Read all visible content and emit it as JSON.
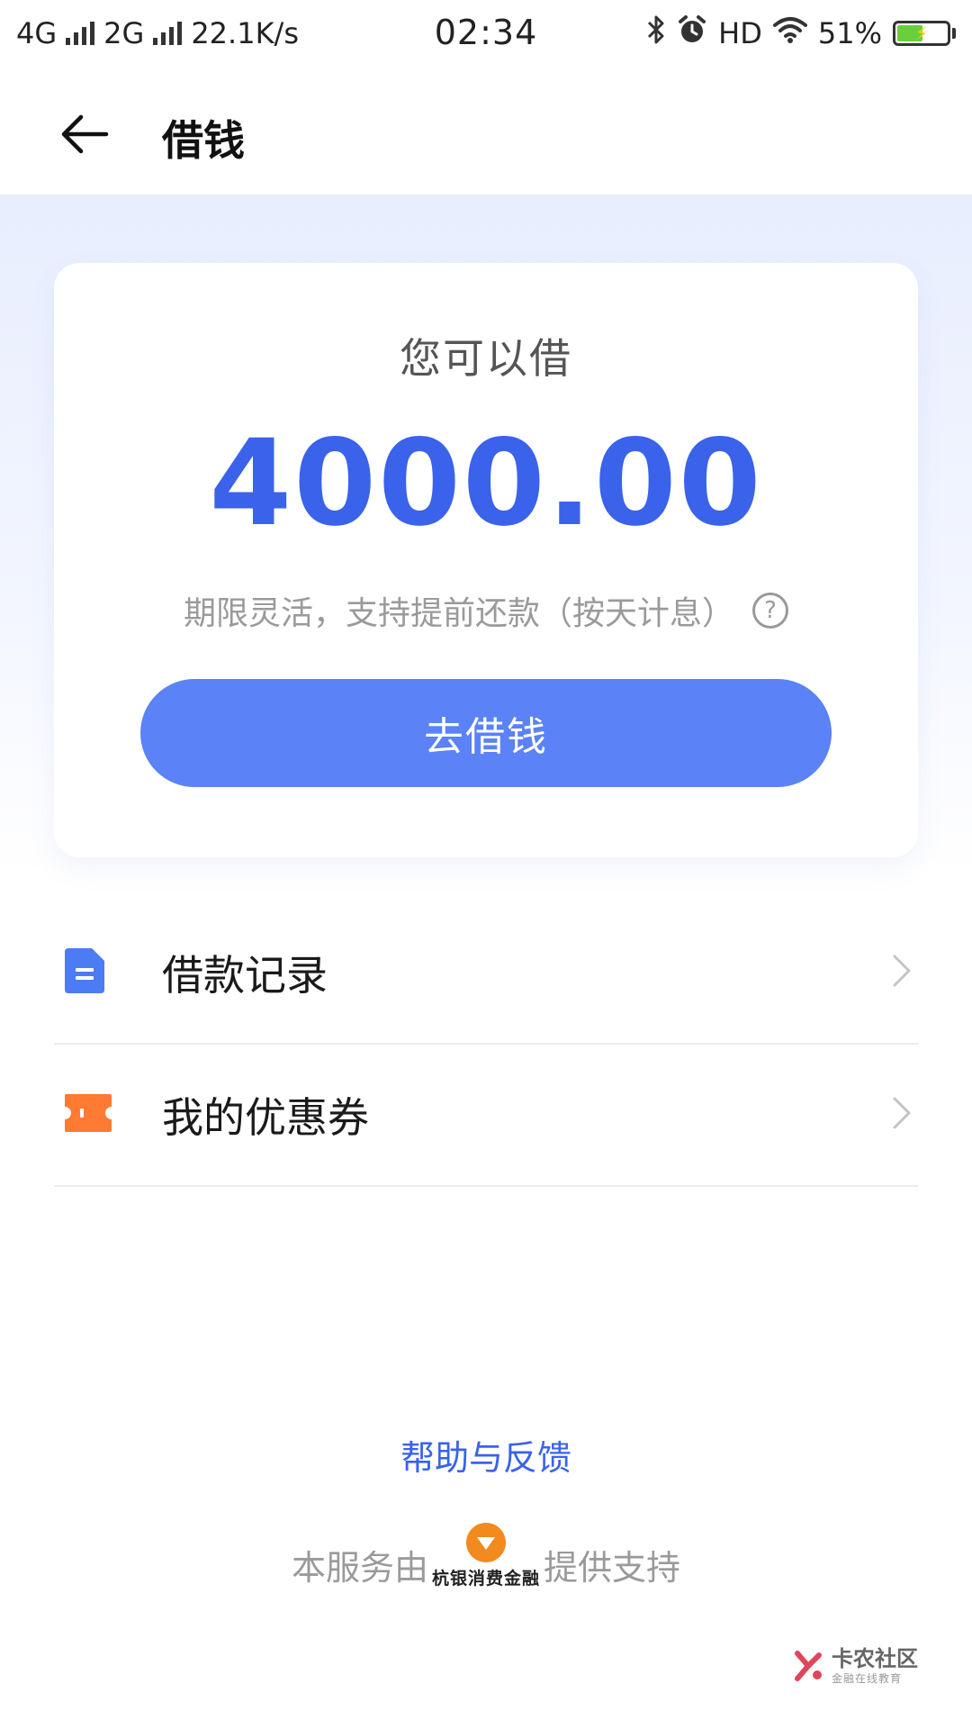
{
  "status_bar": {
    "net1": "4G",
    "net2": "2G",
    "speed": "22.1K/s",
    "time": "02:34",
    "hd": "HD",
    "battery": "51%",
    "battery_level": 0.51
  },
  "header": {
    "title": "借钱"
  },
  "card": {
    "label": "您可以借",
    "amount": "4000.00",
    "note": "期限灵活，支持提前还款（按天计息）",
    "help_glyph": "?",
    "button_label": "去借钱"
  },
  "menu": {
    "items": [
      {
        "label": "借款记录",
        "icon": "document-icon"
      },
      {
        "label": "我的优惠券",
        "icon": "coupon-icon"
      }
    ]
  },
  "footer": {
    "help_link": "帮助与反馈",
    "service_prefix": "本服务由",
    "provider_name": "杭银消费金融",
    "service_suffix": "提供支持",
    "watermark_main": "卡农社区",
    "watermark_sub": "金融在线教育"
  },
  "colors": {
    "accent": "#3a62ea",
    "button": "#5b82f6",
    "coupon": "#ff7a33",
    "doc": "#4b7cf3",
    "provider_logo": "#f28a1e"
  }
}
